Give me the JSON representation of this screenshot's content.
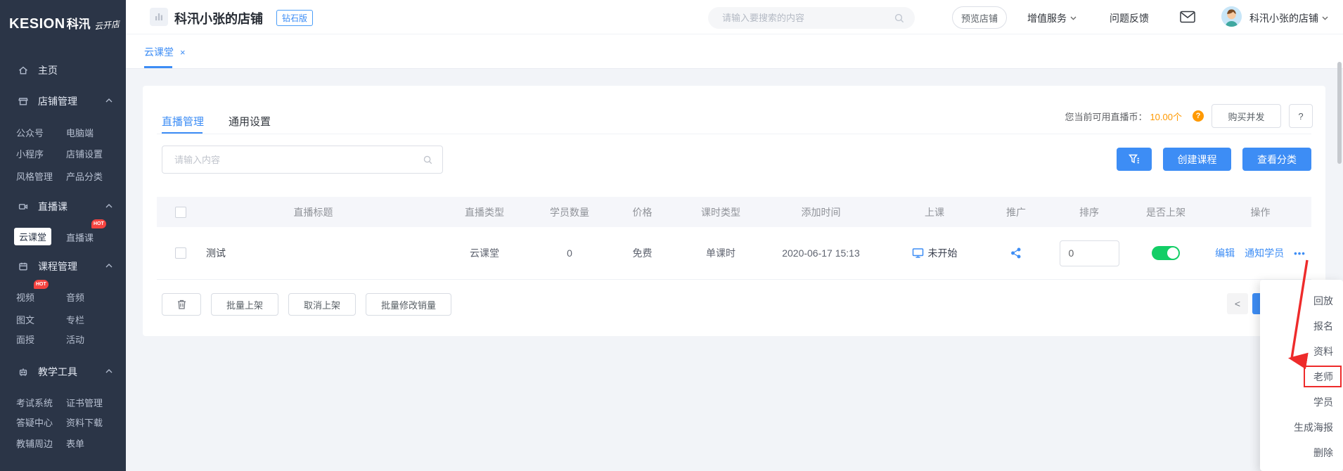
{
  "colors": {
    "primary": "#3D8DF5",
    "success": "#13CE66",
    "warning": "#FF9900",
    "annotation_red": "#EE2B2B",
    "sidebar_bg": "#2B3547"
  },
  "sidebar": {
    "brand": "KESION",
    "brand_cn": "科汛",
    "brand_slogan": "云开店",
    "home_label": "主页",
    "hot_badge": "HOT",
    "groups": [
      {
        "label": "店铺管理",
        "items": [
          "公众号",
          "电脑端",
          "小程序",
          "店铺设置",
          "风格管理",
          "产品分类"
        ]
      },
      {
        "label": "直播课",
        "items": [
          "云课堂",
          "直播课"
        ],
        "active_item": "云课堂",
        "hot_item": "直播课"
      },
      {
        "label": "课程管理",
        "items": [
          "视频",
          "音频",
          "图文",
          "专栏",
          "面授",
          "活动"
        ],
        "hot_item": "视频"
      },
      {
        "label": "教学工具",
        "items": [
          "考试系统",
          "证书管理",
          "答疑中心",
          "资料下载",
          "教辅周边",
          "表单"
        ]
      }
    ]
  },
  "header": {
    "shop_name": "科汛小张的店铺",
    "plan_badge": "钻石版",
    "search_placeholder": "请输入要搜索的内容",
    "preview_button": "预览店铺",
    "value_service": "增值服务",
    "feedback": "问题反馈",
    "account_name": "科汛小张的店铺"
  },
  "tabbar": {
    "active_tab": "云课堂",
    "close": "×"
  },
  "panel": {
    "tabs": [
      "直播管理",
      "通用设置"
    ],
    "coin_label": "您当前可用直播币：",
    "coin_value": "10.00个",
    "buy_button": "购买并发",
    "help_button": "?",
    "filter_search_placeholder": "请输入内容",
    "create_button": "创建课程",
    "view_category_button": "查看分类"
  },
  "table": {
    "headers": [
      "直播标题",
      "直播类型",
      "学员数量",
      "价格",
      "课时类型",
      "添加时间",
      "上课",
      "推广",
      "排序",
      "是否上架",
      "操作"
    ],
    "row": {
      "title": "测试",
      "live_type": "云课堂",
      "student_count": "0",
      "price": "免费",
      "lesson_type": "单课时",
      "added_time": "2020-06-17 15:13",
      "class_status": "未开始",
      "sort_value": "0",
      "on_shelf": true,
      "action_edit": "编辑",
      "action_notify": "通知学员",
      "action_more": "•••"
    }
  },
  "batch": {
    "put_on_button": "批量上架",
    "take_off_button": "取消上架",
    "modify_sales_button": "批量修改销量"
  },
  "pagination": {
    "prev": "<"
  },
  "context_menu": {
    "items": [
      "回放",
      "报名",
      "资料",
      "老师",
      "学员",
      "生成海报",
      "删除"
    ],
    "highlighted_item": "老师"
  }
}
